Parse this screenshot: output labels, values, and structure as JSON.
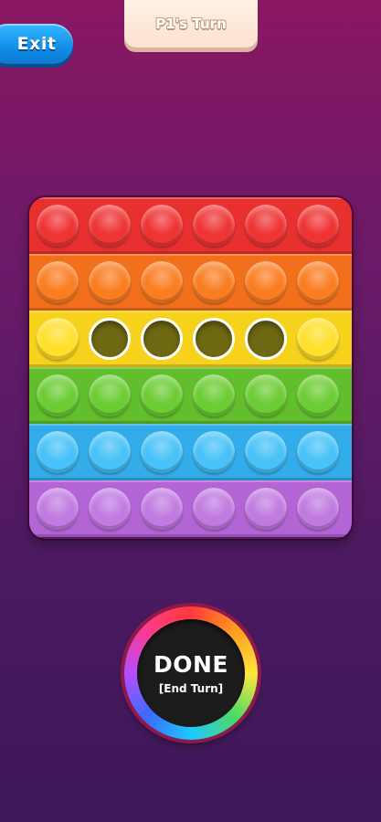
{
  "header": {
    "exit_label": "Exit",
    "turn_label": "P1's Turn"
  },
  "board": {
    "columns": 6,
    "rows": [
      {
        "color": "red",
        "row_hex": "#e8302f",
        "bubble_hex": "#ef3434",
        "popped": [
          false,
          false,
          false,
          false,
          false,
          false
        ]
      },
      {
        "color": "orange",
        "row_hex": "#f2701c",
        "bubble_hex": "#fa7d22",
        "popped": [
          false,
          false,
          false,
          false,
          false,
          false
        ]
      },
      {
        "color": "yellow",
        "row_hex": "#f6d21d",
        "bubble_hex": "#ffe02c",
        "popped": [
          false,
          true,
          true,
          true,
          true,
          false
        ]
      },
      {
        "color": "green",
        "row_hex": "#62be2c",
        "bubble_hex": "#6ccc34",
        "popped": [
          false,
          false,
          false,
          false,
          false,
          false
        ]
      },
      {
        "color": "blue",
        "row_hex": "#33acea",
        "bubble_hex": "#48c2f8",
        "popped": [
          false,
          false,
          false,
          false,
          false,
          false
        ]
      },
      {
        "color": "purple",
        "row_hex": "#b365d6",
        "bubble_hex": "#c07ae0",
        "popped": [
          false,
          false,
          false,
          false,
          false,
          false
        ]
      }
    ]
  },
  "done_button": {
    "title": "DONE",
    "subtitle": "[End Turn]"
  }
}
